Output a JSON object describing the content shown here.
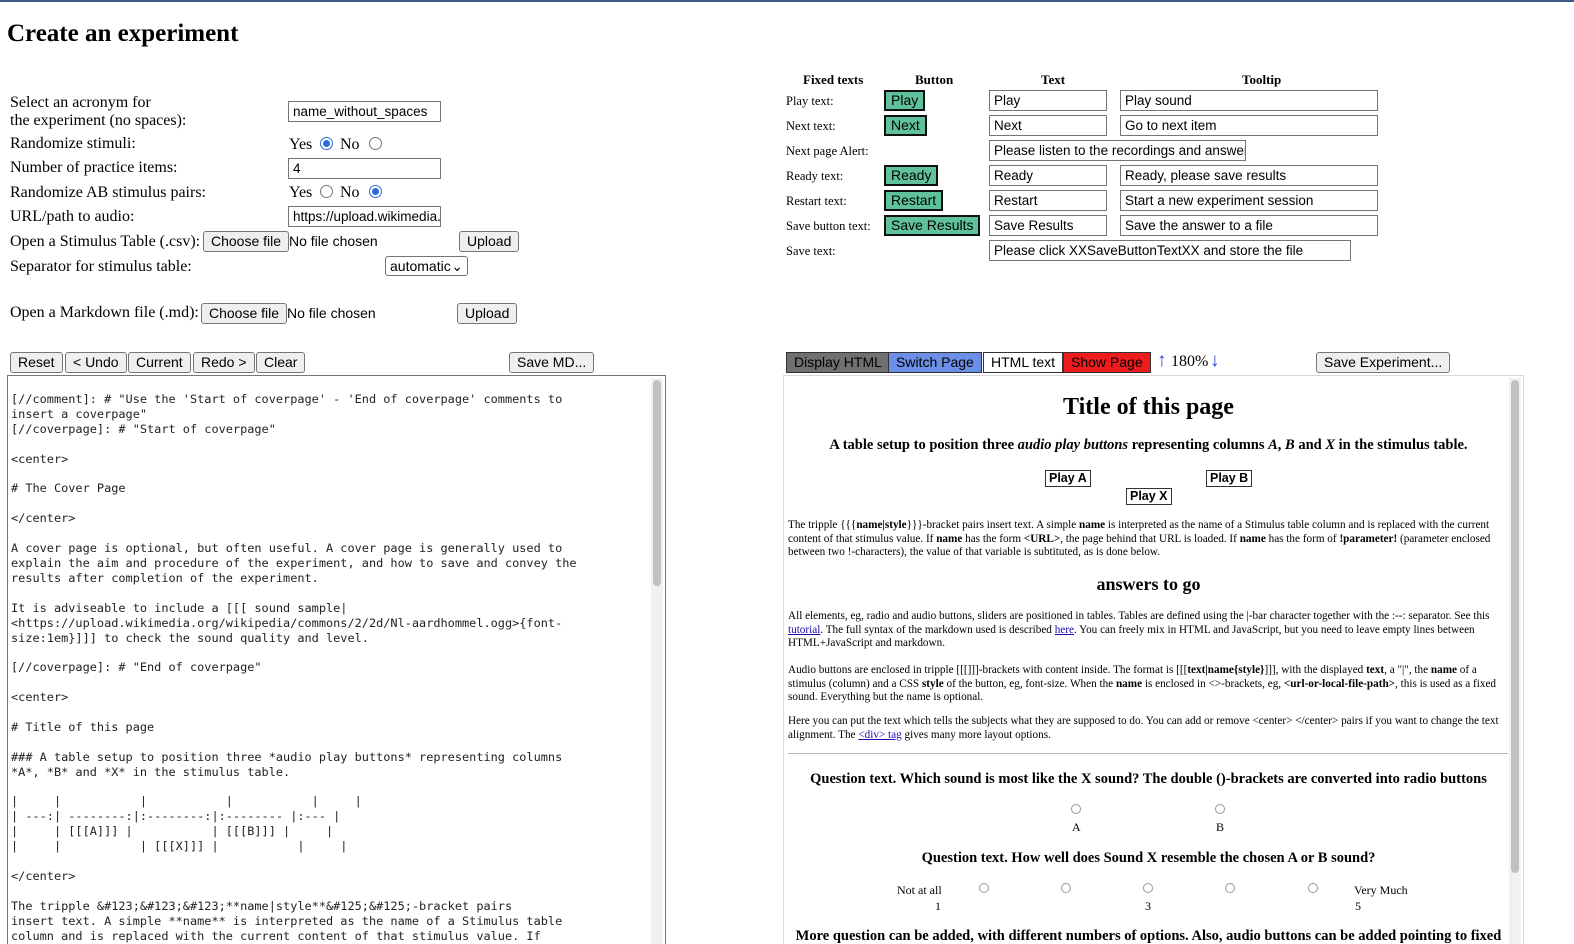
{
  "page": {
    "title": "Create an experiment"
  },
  "form": {
    "acronym_label_1": "Select an acronym for",
    "acronym_label_2": "the experiment (no spaces):",
    "acronym_value": "name_without_spaces",
    "randomize_label": "Randomize stimuli:",
    "yes": "Yes",
    "no": "No",
    "practice_label": "Number of practice items:",
    "practice_value": "4",
    "randomize_ab_label": "Randomize AB stimulus pairs:",
    "audio_label": "URL/path to audio:",
    "audio_value": "https://upload.wikimedia.",
    "stimulus_table_label": "Open a Stimulus Table (.csv):",
    "choose_file": "Choose file",
    "no_file": "No file chosen",
    "upload": "Upload",
    "separator_label": "Separator for stimulus table:",
    "separator_value": "automatic",
    "markdown_label": "Open a Markdown file (.md):"
  },
  "fixed": {
    "headers": {
      "fixed": "Fixed texts",
      "button": "Button",
      "text": "Text",
      "tooltip": "Tooltip"
    },
    "rows": [
      {
        "label": "Play text:",
        "button": "Play",
        "text": "Play",
        "tooltip": "Play sound"
      },
      {
        "label": "Next text:",
        "button": "Next",
        "text": "Next",
        "tooltip": "Go to next item"
      },
      {
        "label": "Next page Alert:",
        "text": "Please listen to the recordings and answer"
      },
      {
        "label": "Ready text:",
        "button": "Ready",
        "text": "Ready",
        "tooltip": "Ready, please save results"
      },
      {
        "label": "Restart text:",
        "button": "Restart",
        "text": "Restart",
        "tooltip": "Start a new experiment session"
      },
      {
        "label": "Save button text:",
        "button": "Save Results",
        "text": "Save Results",
        "tooltip": "Save the answer to a file"
      },
      {
        "label": "Save text:",
        "text": "Please click XXSaveButtonTextXX and store the file"
      }
    ]
  },
  "toolbar": {
    "reset": "Reset",
    "undo": "< Undo",
    "current": "Current",
    "redo": "Redo >",
    "clear": "Clear",
    "save_md": "Save MD...",
    "display_html": "Display HTML",
    "switch_page": "Switch Page",
    "html_text": "HTML text",
    "show_page": "Show Page",
    "zoom_up": "↑",
    "zoom": "180%",
    "zoom_down": "↓",
    "save_experiment": "Save Experiment..."
  },
  "colors": {
    "green_button": "#5fc29b",
    "display_html": "#707070",
    "switch_page": "#6b8ee6",
    "show_page": "#ee1c1c",
    "zoom_arrow": "#2244cc"
  },
  "editor": {
    "text": "[//comment]: # \"Use the 'Start of coverpage' - 'End of coverpage' comments to\ninsert a coverpage\"\n[//coverpage]: # \"Start of coverpage\"\n\n<center>\n\n# The Cover Page\n\n</center>\n\nA cover page is optional, but often useful. A cover page is generally used to\nexplain the aim and procedure of the experiment, and how to save and convey the\nresults after completion of the experiment.\n\nIt is adviseable to include a [[[ sound sample|\n<https://upload.wikimedia.org/wikipedia/commons/2/2d/Nl-aardhommel.ogg>{font-\nsize:1em}]]] to check the sound quality and level.\n\n[//coverpage]: # \"End of coverpage\"\n\n<center>\n\n# Title of this page\n\n### A table setup to position three *audio play buttons* representing columns\n*A*, *B* and *X* in the stimulus table.\n\n|     |           |           |           |     |\n| ---:| --------:|:--------:|:-------- |:--- |\n|     | [[[A]]] |           | [[[B]]] |     |\n|     |           | [[[X]]] |           |     |\n\n</center>\n\nThe tripple &#123;&#123;&#123;**name|style**&#125;&#125;-bracket pairs\ninsert text. A simple **name** is interpreted as the name of a Stimulus table\ncolumn and is replaced with the current content of that stimulus value. If"
  },
  "preview": {
    "title": "Title of this page",
    "subtitle_a": "A table setup to position three ",
    "subtitle_em": "audio play buttons",
    "subtitle_b": " representing columns ",
    "subtitle_A": "A",
    "subtitle_comma": ", ",
    "subtitle_B": "B",
    "subtitle_and": " and ",
    "subtitle_X": "X",
    "subtitle_c": " in the stimulus table.",
    "play_a": "Play A",
    "play_b": "Play B",
    "play_x": "Play X",
    "para1_a": "The tripple {{{",
    "para1_b": "name|style",
    "para1_c": "}}}-bracket pairs insert text. A simple ",
    "para1_d": "name",
    "para1_e": " is interpreted as the name of a Stimulus table column and is replaced with the current content of that stimulus value. If ",
    "para1_f": "name",
    "para1_g": " has the form ",
    "para1_h": "<URL>",
    "para1_i": ", the page behind that URL is loaded. If ",
    "para1_j": "name",
    "para1_k": " has the form of ",
    "para1_l": "!parameter!",
    "para1_m": " (parameter enclosed between two !-characters), the value of that variable is subtituted, as is done below.",
    "answers": "answers to go",
    "para2_a": "All elements, eg, radio and audio buttons, sliders are positioned in tables. Tables are defined using the |-bar character together with the :--: separator. See this ",
    "para2_link1": "tutorial",
    "para2_b": ". The full syntax of the markdown used is described ",
    "para2_link2": "here",
    "para2_c": ". You can freely mix in HTML and JavaScript, but you need to leave empty lines between HTML+JavaScript and markdown.",
    "para3_a": "Audio buttons are enclosed in tripple [[[]]]-brackets with content inside. The format is [[[",
    "para3_b": "text|name{style}",
    "para3_c": "]]], with the displayed ",
    "para3_d": "text",
    "para3_e": ", a \"|\", the ",
    "para3_f": "name",
    "para3_g": " of a stimulus (column) and a CSS ",
    "para3_h": "style",
    "para3_i": " of the button, eg, font-size. When the ",
    "para3_j": "name",
    "para3_k": " is enclosed in <>-brackets, eg, ",
    "para3_l": "<url-or-local-file-path>",
    "para3_m": ", this is used as a fixed sound. Everything but the name is optional.",
    "para4_a": "Here you can put the text which tells the subjects what they are supposed to do. You can add or remove <center> </center> pairs if you want to change the text alignment. The ",
    "para4_link": "<div> tag",
    "para4_b": " gives many more layout options.",
    "question1": "Question text. Which sound is most like the X sound? The double ()-brackets are converted into radio buttons",
    "q1_a": "A",
    "q1_b": "B",
    "question2": "Question text. How well does Sound X resemble the chosen A or B sound?",
    "not_at_all": "Not at all",
    "very_much": "Very Much",
    "scale_1": "1",
    "scale_3": "3",
    "scale_5": "5",
    "bottom": "More question can be added, with different numbers of options. Also, audio buttons can be added pointing to fixed"
  }
}
